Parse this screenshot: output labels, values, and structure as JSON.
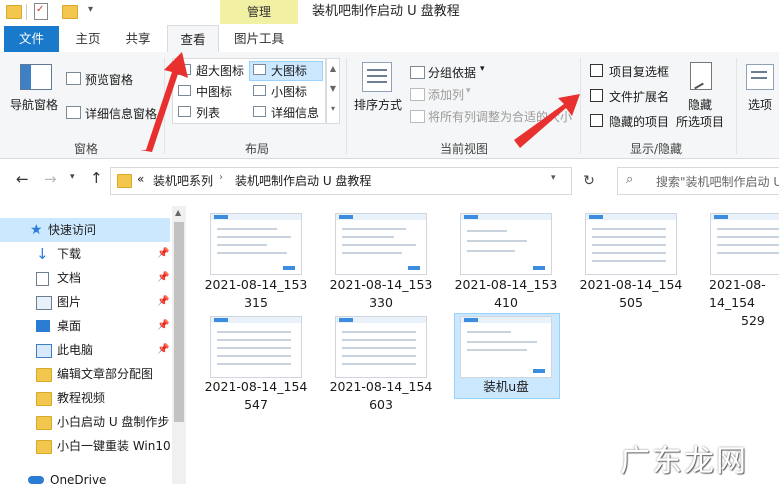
{
  "window": {
    "title": "装机吧制作启动 U 盘教程",
    "context_tab": "管理"
  },
  "tabs": [
    {
      "label": "文件"
    },
    {
      "label": "主页"
    },
    {
      "label": "共享"
    },
    {
      "label": "查看"
    },
    {
      "label": "图片工具"
    }
  ],
  "ribbon": {
    "panes": {
      "nav_pane": "导航窗格",
      "preview": "预览窗格",
      "details": "详细信息窗格",
      "group": "窗格"
    },
    "layout": {
      "xl_icons": "超大图标",
      "large_icons": "大图标",
      "medium_icons": "中图标",
      "small_icons": "小图标",
      "list": "列表",
      "details": "详细信息",
      "group": "布局"
    },
    "current_view": {
      "sort": "排序方式",
      "group_by": "分组依据",
      "add_column": "添加列",
      "fit_columns": "将所有列调整为合适的大小",
      "group": "当前视图"
    },
    "show_hide": {
      "item_checkboxes": "项目复选框",
      "file_ext": "文件扩展名",
      "hidden_items": "隐藏的项目",
      "hide": "隐藏",
      "hide2": "所选项目",
      "group": "显示/隐藏"
    },
    "options": "选项"
  },
  "address": {
    "sep": "«",
    "crumb1": "装机吧系列",
    "crumb2": "装机吧制作启动 U 盘教程",
    "search_placeholder": "搜索\"装机吧制作启动 U 盘\""
  },
  "nav": [
    {
      "label": "快速访问"
    },
    {
      "label": "下载"
    },
    {
      "label": "文档"
    },
    {
      "label": "图片"
    },
    {
      "label": "桌面"
    },
    {
      "label": "此电脑"
    },
    {
      "label": "编辑文章部分配图"
    },
    {
      "label": "教程视频"
    },
    {
      "label": "小白启动 U 盘制作步"
    },
    {
      "label": "小白一键重装 Win10"
    },
    {
      "label": "OneDrive"
    }
  ],
  "files": [
    {
      "l1": "2021-08-14_153",
      "l2": "315"
    },
    {
      "l1": "2021-08-14_153",
      "l2": "330"
    },
    {
      "l1": "2021-08-14_153",
      "l2": "410"
    },
    {
      "l1": "2021-08-14_154",
      "l2": "505"
    },
    {
      "l1": "2021-08-14_154",
      "l2": "529"
    },
    {
      "l1": "2021-08-14_154",
      "l2": "547"
    },
    {
      "l1": "2021-08-14_154",
      "l2": "603"
    },
    {
      "l1": "装机u盘",
      "l2": ""
    }
  ],
  "watermark": "广东龙网",
  "colors": {
    "file_tab": "#1979ca",
    "manage_tab": "#f2f0a2",
    "selection": "#cce8ff",
    "arrow": "#e8312e"
  }
}
